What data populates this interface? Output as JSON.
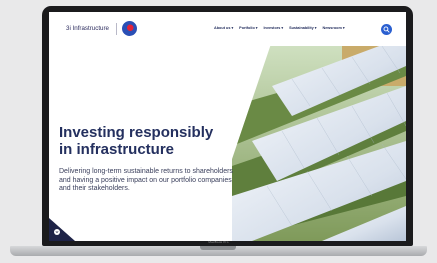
{
  "brand": {
    "logo_text": "3i Infrastructure"
  },
  "nav": {
    "items": [
      {
        "label": "About us"
      },
      {
        "label": "Portfolio"
      },
      {
        "label": "Investors"
      },
      {
        "label": "Sustainability"
      },
      {
        "label": "Newsroom"
      }
    ]
  },
  "hero": {
    "headline_line1": "Investing responsibly",
    "headline_line2": "in infrastructure",
    "subtext": "Delivering long-term sustainable returns to shareholders and having a positive impact on our portfolio companies and their stakeholders."
  },
  "device": {
    "label": "MacBook Pro"
  },
  "colors": {
    "brand_navy": "#24305f",
    "accent_blue": "#2a5fd0",
    "badge_red": "#e2223a"
  },
  "icons": {
    "search": "search-icon",
    "scroll": "scroll-down-icon",
    "chevron": "chevron-down-icon"
  }
}
